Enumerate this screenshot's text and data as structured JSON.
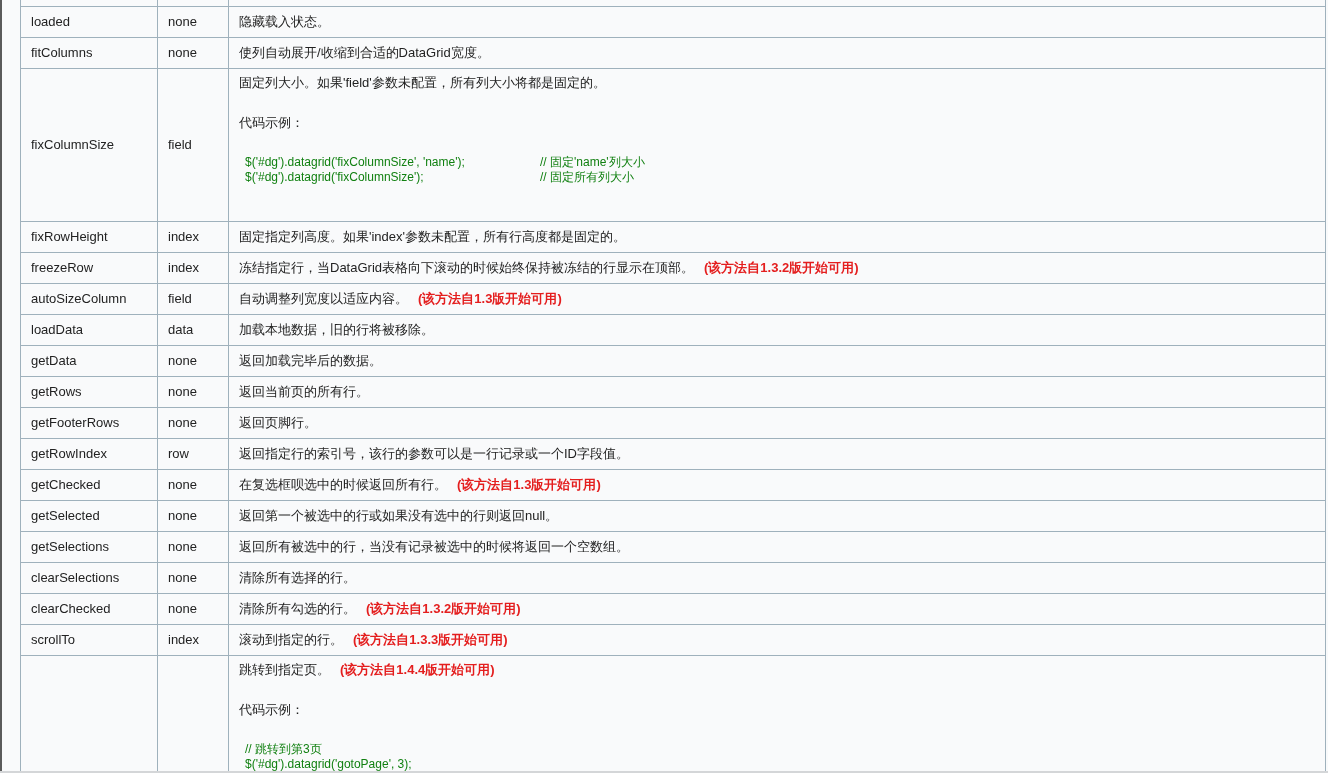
{
  "table": {
    "rows": [
      {
        "method": "loaded",
        "parameter": "none",
        "description": [
          {
            "kind": "text",
            "text": "隐藏载入状态。"
          }
        ]
      },
      {
        "method": "fitColumns",
        "parameter": "none",
        "description": [
          {
            "kind": "text",
            "text": "使列自动展开/收缩到合适的DataGrid宽度。"
          }
        ]
      },
      {
        "method": "fixColumnSize",
        "parameter": "field",
        "description": [
          {
            "kind": "text",
            "text": "固定列大小。如果'field'参数未配置，所有列大小将都是固定的。"
          },
          {
            "kind": "text",
            "text": "代码示例："
          },
          {
            "kind": "code",
            "lines": [
              {
                "code": "$('#dg').datagrid('fixColumnSize', 'name');",
                "comment": "// 固定'name'列大小"
              },
              {
                "code": "$('#dg').datagrid('fixColumnSize');",
                "comment": "// 固定所有列大小"
              }
            ]
          }
        ]
      },
      {
        "method": "fixRowHeight",
        "parameter": "index",
        "description": [
          {
            "kind": "text",
            "text": "固定指定列高度。如果'index'参数未配置，所有行高度都是固定的。"
          }
        ]
      },
      {
        "method": "freezeRow",
        "parameter": "index",
        "description": [
          {
            "kind": "text",
            "text": "冻结指定行，当DataGrid表格向下滚动的时候始终保持被冻结的行显示在顶部。",
            "note": "(该方法自1.3.2版开始可用)"
          }
        ]
      },
      {
        "method": "autoSizeColumn",
        "parameter": "field",
        "description": [
          {
            "kind": "text",
            "text": "自动调整列宽度以适应内容。",
            "note": "(该方法自1.3版开始可用)"
          }
        ]
      },
      {
        "method": "loadData",
        "parameter": "data",
        "description": [
          {
            "kind": "text",
            "text": "加载本地数据，旧的行将被移除。"
          }
        ]
      },
      {
        "method": "getData",
        "parameter": "none",
        "description": [
          {
            "kind": "text",
            "text": "返回加载完毕后的数据。"
          }
        ]
      },
      {
        "method": "getRows",
        "parameter": "none",
        "description": [
          {
            "kind": "text",
            "text": "返回当前页的所有行。"
          }
        ]
      },
      {
        "method": "getFooterRows",
        "parameter": "none",
        "description": [
          {
            "kind": "text",
            "text": "返回页脚行。"
          }
        ]
      },
      {
        "method": "getRowIndex",
        "parameter": "row",
        "description": [
          {
            "kind": "text",
            "text": "返回指定行的索引号，该行的参数可以是一行记录或一个ID字段值。"
          }
        ]
      },
      {
        "method": "getChecked",
        "parameter": "none",
        "description": [
          {
            "kind": "text",
            "text": "在复选框呗选中的时候返回所有行。",
            "note": "(该方法自1.3版开始可用)"
          }
        ]
      },
      {
        "method": "getSelected",
        "parameter": "none",
        "description": [
          {
            "kind": "text",
            "text": "返回第一个被选中的行或如果没有选中的行则返回null。"
          }
        ]
      },
      {
        "method": "getSelections",
        "parameter": "none",
        "description": [
          {
            "kind": "text",
            "text": "返回所有被选中的行，当没有记录被选中的时候将返回一个空数组。"
          }
        ]
      },
      {
        "method": "clearSelections",
        "parameter": "none",
        "description": [
          {
            "kind": "text",
            "text": "清除所有选择的行。"
          }
        ]
      },
      {
        "method": "clearChecked",
        "parameter": "none",
        "description": [
          {
            "kind": "text",
            "text": "清除所有勾选的行。",
            "note": "(该方法自1.3.2版开始可用)"
          }
        ]
      },
      {
        "method": "scrollTo",
        "parameter": "index",
        "description": [
          {
            "kind": "text",
            "text": "滚动到指定的行。",
            "note": "(该方法自1.3.3版开始可用)"
          }
        ]
      },
      {
        "description": [
          {
            "kind": "text",
            "text": "跳转到指定页。",
            "note": "(该方法自1.4.4版开始可用)"
          },
          {
            "kind": "text",
            "text": "代码示例："
          },
          {
            "kind": "code",
            "lines": [
              {
                "comment": "// 跳转到第3页"
              },
              {
                "code": "$('#dg').datagrid('gotoPage', 3);"
              }
            ]
          }
        ]
      }
    ]
  }
}
